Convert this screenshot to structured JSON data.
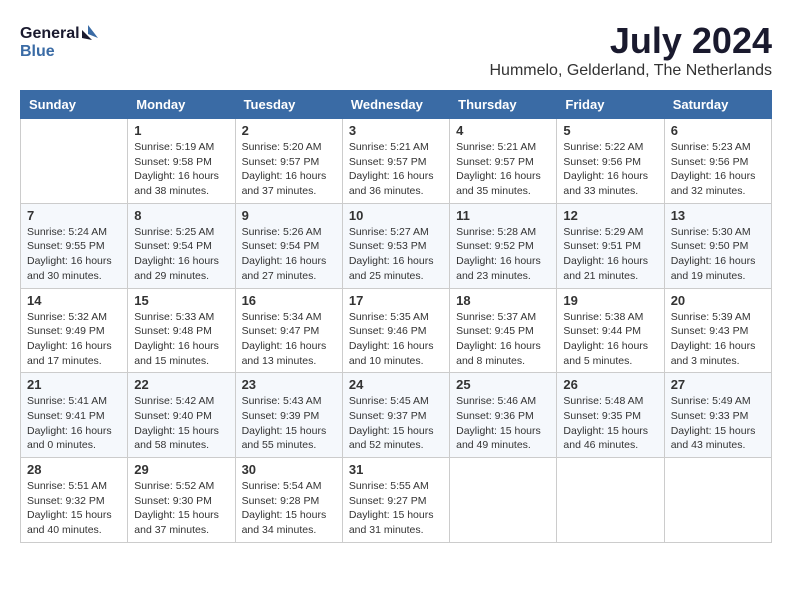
{
  "header": {
    "logo_line1": "General",
    "logo_line2": "Blue",
    "month_year": "July 2024",
    "location": "Hummelo, Gelderland, The Netherlands"
  },
  "days_of_week": [
    "Sunday",
    "Monday",
    "Tuesday",
    "Wednesday",
    "Thursday",
    "Friday",
    "Saturday"
  ],
  "weeks": [
    [
      {
        "day": null,
        "info": null
      },
      {
        "day": "1",
        "info": "Sunrise: 5:19 AM\nSunset: 9:58 PM\nDaylight: 16 hours\nand 38 minutes."
      },
      {
        "day": "2",
        "info": "Sunrise: 5:20 AM\nSunset: 9:57 PM\nDaylight: 16 hours\nand 37 minutes."
      },
      {
        "day": "3",
        "info": "Sunrise: 5:21 AM\nSunset: 9:57 PM\nDaylight: 16 hours\nand 36 minutes."
      },
      {
        "day": "4",
        "info": "Sunrise: 5:21 AM\nSunset: 9:57 PM\nDaylight: 16 hours\nand 35 minutes."
      },
      {
        "day": "5",
        "info": "Sunrise: 5:22 AM\nSunset: 9:56 PM\nDaylight: 16 hours\nand 33 minutes."
      },
      {
        "day": "6",
        "info": "Sunrise: 5:23 AM\nSunset: 9:56 PM\nDaylight: 16 hours\nand 32 minutes."
      }
    ],
    [
      {
        "day": "7",
        "info": "Sunrise: 5:24 AM\nSunset: 9:55 PM\nDaylight: 16 hours\nand 30 minutes."
      },
      {
        "day": "8",
        "info": "Sunrise: 5:25 AM\nSunset: 9:54 PM\nDaylight: 16 hours\nand 29 minutes."
      },
      {
        "day": "9",
        "info": "Sunrise: 5:26 AM\nSunset: 9:54 PM\nDaylight: 16 hours\nand 27 minutes."
      },
      {
        "day": "10",
        "info": "Sunrise: 5:27 AM\nSunset: 9:53 PM\nDaylight: 16 hours\nand 25 minutes."
      },
      {
        "day": "11",
        "info": "Sunrise: 5:28 AM\nSunset: 9:52 PM\nDaylight: 16 hours\nand 23 minutes."
      },
      {
        "day": "12",
        "info": "Sunrise: 5:29 AM\nSunset: 9:51 PM\nDaylight: 16 hours\nand 21 minutes."
      },
      {
        "day": "13",
        "info": "Sunrise: 5:30 AM\nSunset: 9:50 PM\nDaylight: 16 hours\nand 19 minutes."
      }
    ],
    [
      {
        "day": "14",
        "info": "Sunrise: 5:32 AM\nSunset: 9:49 PM\nDaylight: 16 hours\nand 17 minutes."
      },
      {
        "day": "15",
        "info": "Sunrise: 5:33 AM\nSunset: 9:48 PM\nDaylight: 16 hours\nand 15 minutes."
      },
      {
        "day": "16",
        "info": "Sunrise: 5:34 AM\nSunset: 9:47 PM\nDaylight: 16 hours\nand 13 minutes."
      },
      {
        "day": "17",
        "info": "Sunrise: 5:35 AM\nSunset: 9:46 PM\nDaylight: 16 hours\nand 10 minutes."
      },
      {
        "day": "18",
        "info": "Sunrise: 5:37 AM\nSunset: 9:45 PM\nDaylight: 16 hours\nand 8 minutes."
      },
      {
        "day": "19",
        "info": "Sunrise: 5:38 AM\nSunset: 9:44 PM\nDaylight: 16 hours\nand 5 minutes."
      },
      {
        "day": "20",
        "info": "Sunrise: 5:39 AM\nSunset: 9:43 PM\nDaylight: 16 hours\nand 3 minutes."
      }
    ],
    [
      {
        "day": "21",
        "info": "Sunrise: 5:41 AM\nSunset: 9:41 PM\nDaylight: 16 hours\nand 0 minutes."
      },
      {
        "day": "22",
        "info": "Sunrise: 5:42 AM\nSunset: 9:40 PM\nDaylight: 15 hours\nand 58 minutes."
      },
      {
        "day": "23",
        "info": "Sunrise: 5:43 AM\nSunset: 9:39 PM\nDaylight: 15 hours\nand 55 minutes."
      },
      {
        "day": "24",
        "info": "Sunrise: 5:45 AM\nSunset: 9:37 PM\nDaylight: 15 hours\nand 52 minutes."
      },
      {
        "day": "25",
        "info": "Sunrise: 5:46 AM\nSunset: 9:36 PM\nDaylight: 15 hours\nand 49 minutes."
      },
      {
        "day": "26",
        "info": "Sunrise: 5:48 AM\nSunset: 9:35 PM\nDaylight: 15 hours\nand 46 minutes."
      },
      {
        "day": "27",
        "info": "Sunrise: 5:49 AM\nSunset: 9:33 PM\nDaylight: 15 hours\nand 43 minutes."
      }
    ],
    [
      {
        "day": "28",
        "info": "Sunrise: 5:51 AM\nSunset: 9:32 PM\nDaylight: 15 hours\nand 40 minutes."
      },
      {
        "day": "29",
        "info": "Sunrise: 5:52 AM\nSunset: 9:30 PM\nDaylight: 15 hours\nand 37 minutes."
      },
      {
        "day": "30",
        "info": "Sunrise: 5:54 AM\nSunset: 9:28 PM\nDaylight: 15 hours\nand 34 minutes."
      },
      {
        "day": "31",
        "info": "Sunrise: 5:55 AM\nSunset: 9:27 PM\nDaylight: 15 hours\nand 31 minutes."
      },
      {
        "day": null,
        "info": null
      },
      {
        "day": null,
        "info": null
      },
      {
        "day": null,
        "info": null
      }
    ]
  ]
}
